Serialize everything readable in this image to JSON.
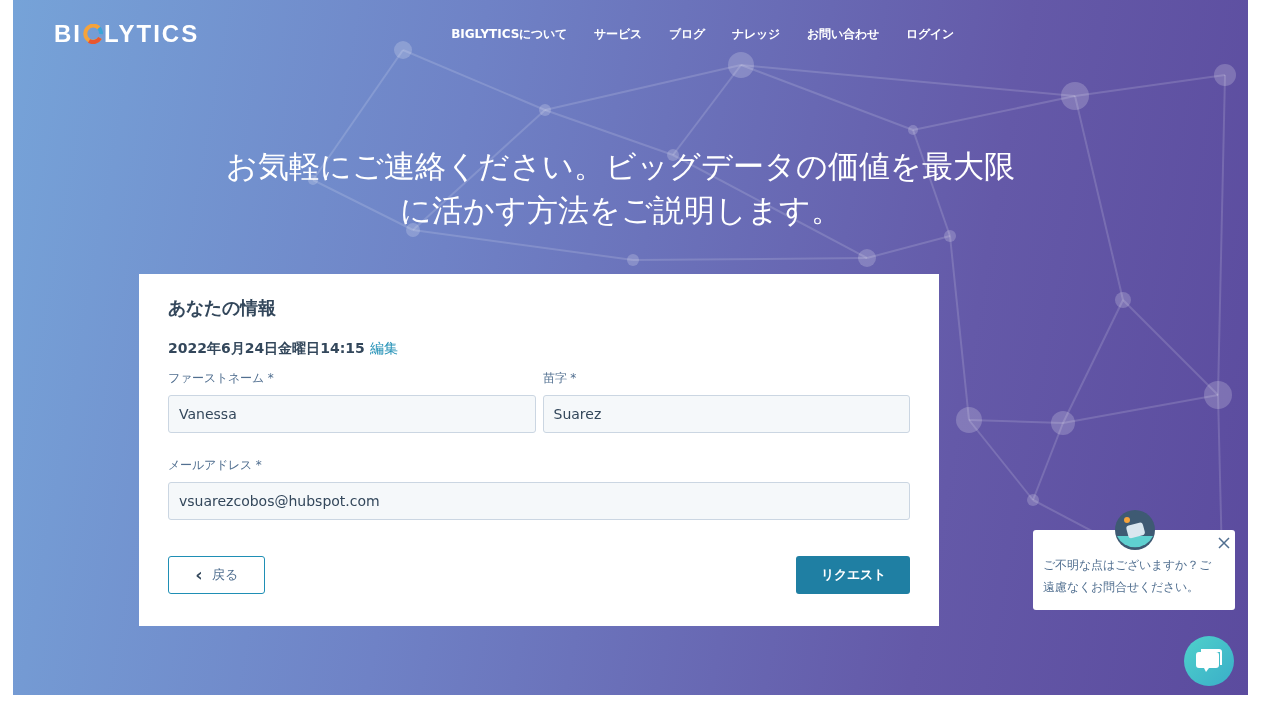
{
  "logo": {
    "before": "BI",
    "after": "LYTICS"
  },
  "nav": [
    {
      "label": "BIGLYTICSについて"
    },
    {
      "label": "サービス"
    },
    {
      "label": "ブログ"
    },
    {
      "label": "ナレッジ"
    },
    {
      "label": "お問い合わせ"
    },
    {
      "label": "ログイン"
    }
  ],
  "headline": "お気軽にご連絡ください。ビッグデータの価値を最大限に活かす方法をご説明します。",
  "form": {
    "title": "あなたの情報",
    "datetime": "2022年6月24日金曜日14:15",
    "edit_link": "編集",
    "field_rows": [
      [
        {
          "label": "ファーストネーム",
          "required": "*",
          "value": "Vanessa"
        },
        {
          "label": "苗字",
          "required": "*",
          "value": "Suarez"
        }
      ],
      [
        {
          "label": "メールアドレス",
          "required": "*",
          "value": "vsuarezcobos@hubspot.com"
        }
      ]
    ],
    "back_icon": "‹",
    "back_button": "戻る",
    "submit_button": "リクエスト"
  },
  "chat": {
    "message": "ご不明な点はございますか？ご遠慮なくお問合せください。"
  }
}
